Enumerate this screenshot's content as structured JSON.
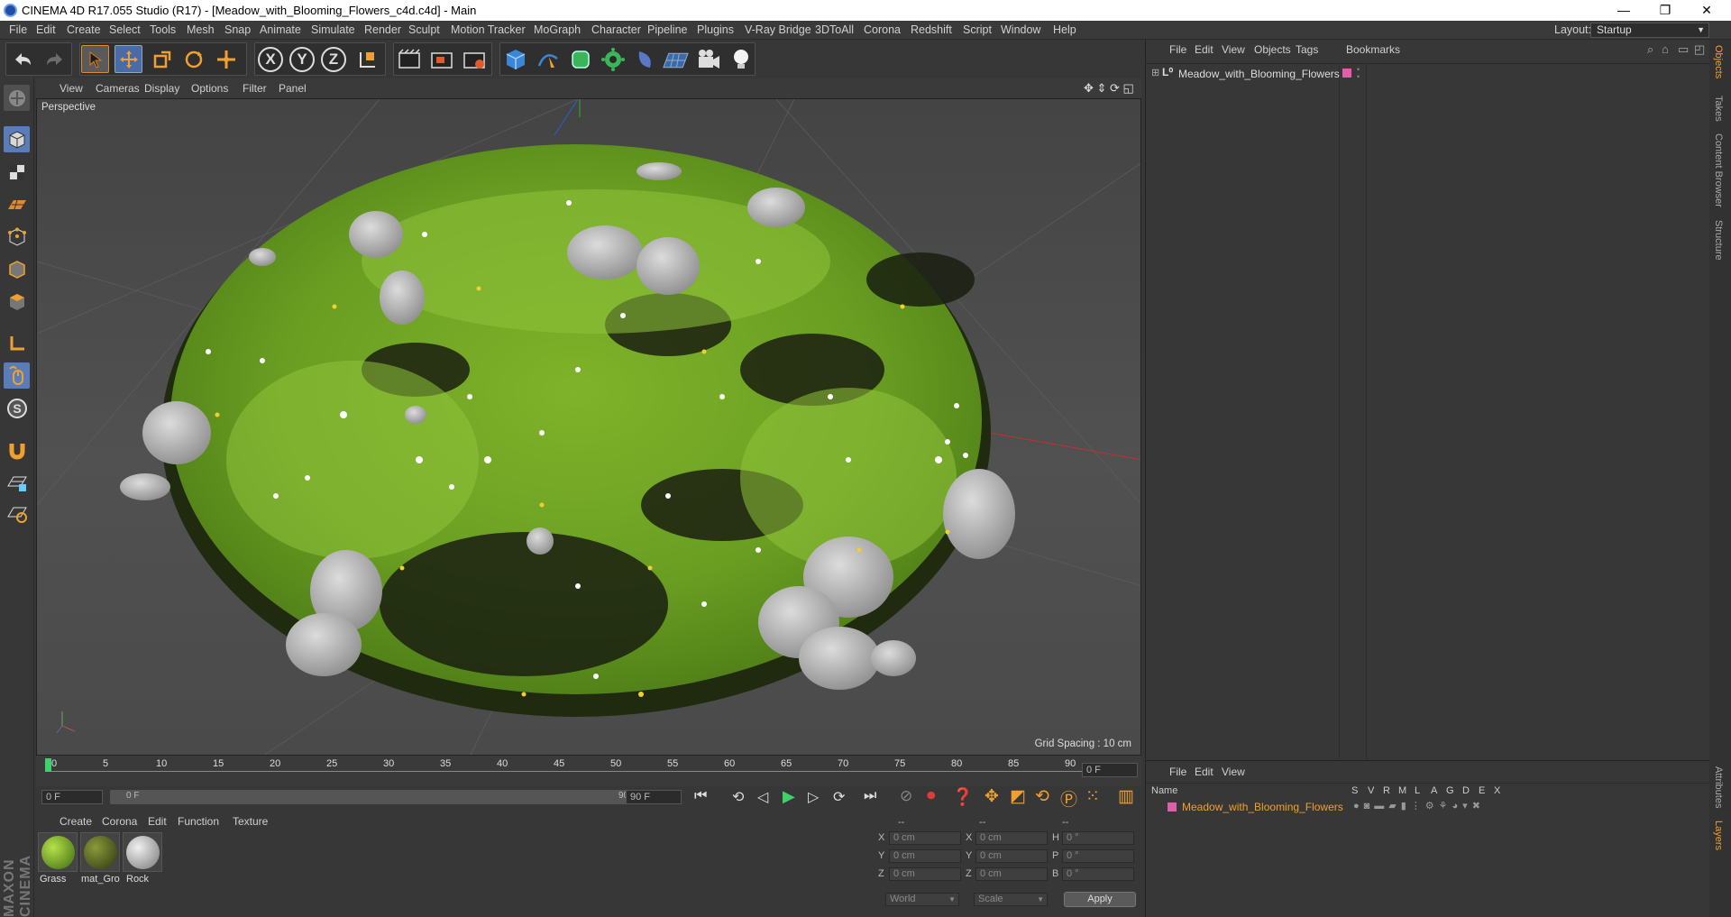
{
  "window": {
    "title": "CINEMA 4D R17.055 Studio (R17) - [Meadow_with_Blooming_Flowers_c4d.c4d] - Main",
    "minimize": "—",
    "restore": "❐",
    "close": "✕"
  },
  "menubar": {
    "items": [
      "File",
      "Edit",
      "Create",
      "Select",
      "Tools",
      "Mesh",
      "Snap",
      "Animate",
      "Simulate",
      "Render",
      "Sculpt",
      "Motion Tracker",
      "MoGraph",
      "Character",
      "Pipeline",
      "Plugins",
      "V-Ray Bridge",
      "3DToAll",
      "Corona",
      "Redshift",
      "Script",
      "Window",
      "Help"
    ],
    "layout_label": "Layout:",
    "layout_value": "Startup"
  },
  "toolbar": {
    "axis_x": "X",
    "axis_y": "Y",
    "axis_z": "Z"
  },
  "viewport": {
    "menu": [
      "View",
      "Cameras",
      "Display",
      "Options",
      "Filter",
      "Panel"
    ],
    "label": "Perspective",
    "grid_spacing": "Grid Spacing : 10 cm"
  },
  "timeline": {
    "ticks": [
      "0",
      "5",
      "10",
      "15",
      "20",
      "25",
      "30",
      "35",
      "40",
      "45",
      "50",
      "55",
      "60",
      "65",
      "70",
      "75",
      "80",
      "85",
      "90"
    ],
    "current_frame": "0 F",
    "start_frame": "0 F",
    "range_start": "0 F",
    "range_end": "90 F",
    "end_frame": "90 F"
  },
  "materials": {
    "menu": [
      "Create",
      "Corona",
      "Edit",
      "Function",
      "Texture"
    ],
    "items": [
      {
        "name": "Grass",
        "color": "#7a9a2a"
      },
      {
        "name": "mat_Gro",
        "color": "#5d6a2c"
      },
      {
        "name": "Rock",
        "color": "#b8b8b8"
      }
    ],
    "brand": "MAXON CINEMA 4D"
  },
  "coordinates": {
    "header": [
      "--",
      "--",
      "--"
    ],
    "rows": [
      {
        "l1": "X",
        "v1": "0 cm",
        "l2": "X",
        "v2": "0 cm",
        "l3": "H",
        "v3": "0 °"
      },
      {
        "l1": "Y",
        "v1": "0 cm",
        "l2": "Y",
        "v2": "0 cm",
        "l3": "P",
        "v3": "0 °"
      },
      {
        "l1": "Z",
        "v1": "0 cm",
        "l2": "Z",
        "v2": "0 cm",
        "l3": "B",
        "v3": "0 °"
      }
    ],
    "mode": "World",
    "transform": "Scale",
    "apply": "Apply"
  },
  "object_manager": {
    "menu": [
      "File",
      "Edit",
      "View",
      "Objects",
      "Tags",
      "Bookmarks"
    ],
    "object_name": "Meadow_with_Blooming_Flowers",
    "layer_color": "#e05fa8"
  },
  "layer_manager": {
    "menu": [
      "File",
      "Edit",
      "View"
    ],
    "columns": [
      "Name",
      "S",
      "V",
      "R",
      "M",
      "L",
      "A",
      "G",
      "D",
      "E",
      "X"
    ],
    "layer_name": "Meadow_with_Blooming_Flowers",
    "layer_color": "#e05fa8"
  },
  "right_tabs": [
    "Objects",
    "Takes",
    "Content Browser",
    "Structure",
    "Attributes",
    "Layers"
  ]
}
